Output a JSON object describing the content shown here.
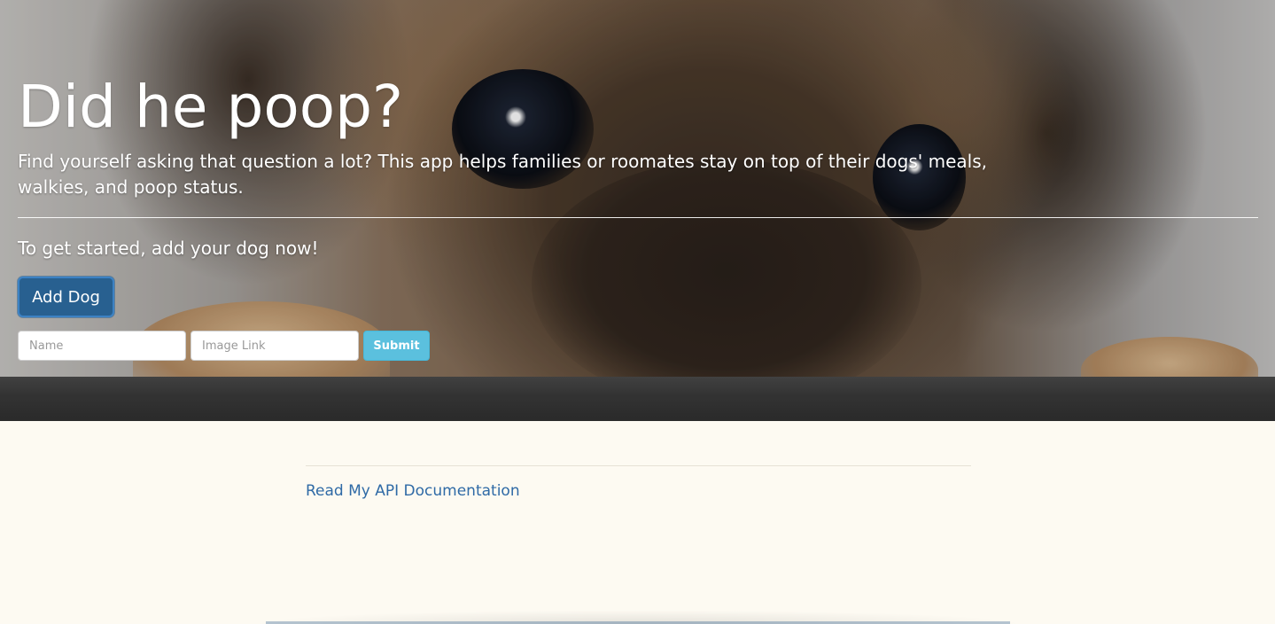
{
  "hero": {
    "title": "Did he poop?",
    "description": "Find yourself asking that question a lot? This app helps families or roomates stay on top of their dogs' meals, walkies, and poop status.",
    "cta_text": "To get started, add your dog now!",
    "background_image": "pug-close-up-photo"
  },
  "add_dog_button": {
    "label": "Add Dog",
    "color": "#286090"
  },
  "form": {
    "name_placeholder": "Name",
    "image_placeholder": "Image Link",
    "submit_label": "Submit",
    "submit_color": "#5bc0de"
  },
  "footer": {
    "api_link_text": "Read My API Documentation",
    "link_color": "#2f6aa6"
  }
}
